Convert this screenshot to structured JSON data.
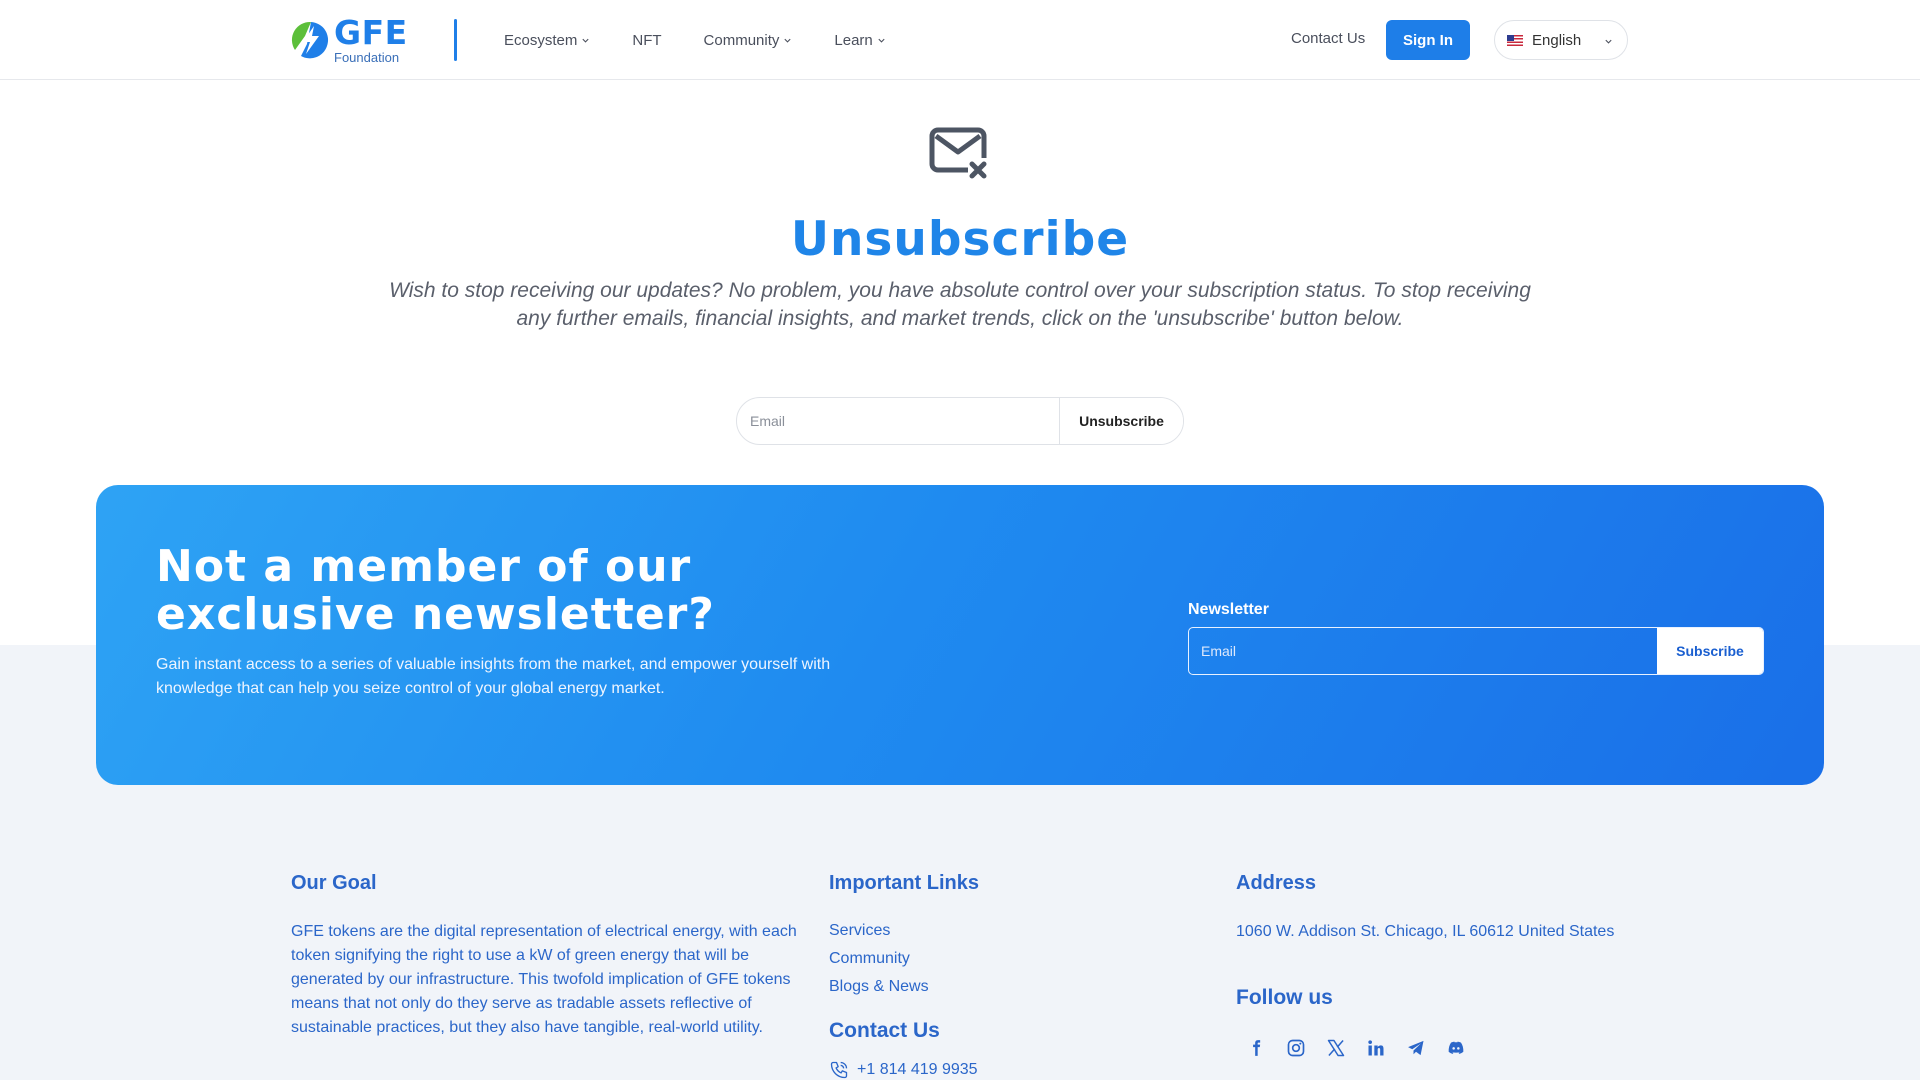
{
  "header": {
    "logo_title": "GFE",
    "logo_subtitle": "Foundation",
    "nav": [
      {
        "label": "Ecosystem",
        "dropdown": true
      },
      {
        "label": "NFT",
        "dropdown": false
      },
      {
        "label": "Community",
        "dropdown": true
      },
      {
        "label": "Learn",
        "dropdown": true
      }
    ],
    "contact_label": "Contact Us",
    "signin_label": "Sign In",
    "language": "English"
  },
  "hero": {
    "icon": "mail-x-icon",
    "title": "Unsubscribe",
    "description": "Wish to stop receiving our updates? No problem, you have absolute control over your subscription status. To stop receiving any further emails, financial insights, and market trends, click on the 'unsubscribe' button below.",
    "email_placeholder": "Email",
    "button_label": "Unsubscribe"
  },
  "newsletter": {
    "title": "Not a member of our exclusive newsletter?",
    "description": "Gain instant access to a series of valuable insights from the market, and empower yourself with knowledge that can help you seize control of your global energy market.",
    "label": "Newsletter",
    "email_placeholder": "Email",
    "button_label": "Subscribe"
  },
  "footer": {
    "goal_heading": "Our Goal",
    "goal_text": "GFE tokens are the digital representation of electrical energy, with each token signifying the right to use a kW of green energy that will be generated by our infrastructure. This twofold implication of GFE tokens means that not only do they serve as tradable assets reflective of sustainable practices, but they also have tangible, real-world utility.",
    "links_heading": "Important Links",
    "links": [
      "Services",
      "Community",
      "Blogs & News"
    ],
    "contact_heading": "Contact Us",
    "phone": "+1 814 419 9935",
    "address_heading": "Address",
    "address": "1060 W. Addison St. Chicago, IL 60612 United States",
    "follow_heading": "Follow us",
    "socials": [
      "facebook-icon",
      "instagram-icon",
      "x-twitter-icon",
      "linkedin-icon",
      "telegram-icon",
      "discord-icon"
    ]
  },
  "colors": {
    "brand_blue": "#1f85e8",
    "footer_text": "#2b66c9",
    "card_gradient_start": "#2ea3f4",
    "card_gradient_end": "#1a6fe8"
  }
}
